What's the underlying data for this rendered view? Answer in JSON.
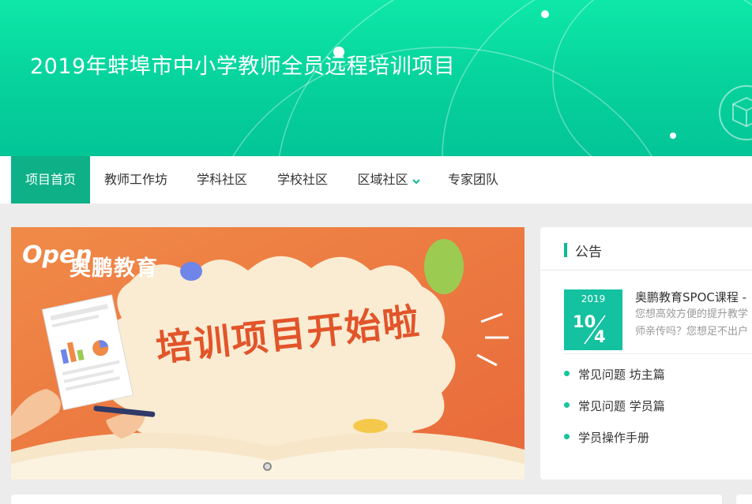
{
  "header": {
    "title": "2019年蚌埠市中小学教师全员远程培训项目"
  },
  "nav": {
    "items": [
      {
        "label": "项目首页",
        "active": true
      },
      {
        "label": "教师工作坊"
      },
      {
        "label": "学科社区"
      },
      {
        "label": "学校社区"
      },
      {
        "label": "区域社区",
        "has_dropdown": true
      },
      {
        "label": "专家团队"
      }
    ]
  },
  "banner": {
    "brand_mark": "Open",
    "brand_name": "奥鹏教育",
    "headline": "培训项目开始啦",
    "slide_count": 1,
    "current_slide": 1
  },
  "notice": {
    "title": "公告",
    "featured": {
      "year": "2019",
      "month": "10",
      "day": "4",
      "title": "奥鹏教育SPOC课程 -",
      "desc_line1": "您想高效方便的提升教学",
      "desc_line2": "师亲传吗？您想足不出户"
    },
    "links": [
      {
        "label": "常见问题 坊主篇"
      },
      {
        "label": "常见问题 学员篇"
      },
      {
        "label": "学员操作手册"
      }
    ]
  },
  "colors": {
    "header_green": "#06d19c",
    "nav_active": "#0db087",
    "accent_teal": "#14c1a0",
    "banner_orange": "#ea7a3f"
  }
}
